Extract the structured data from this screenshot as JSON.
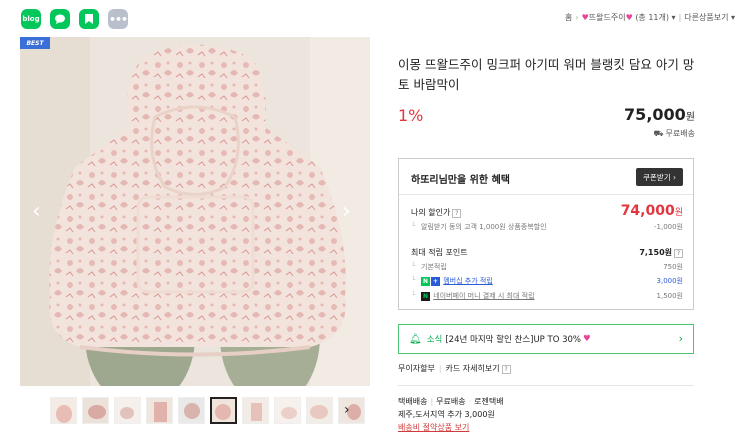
{
  "share": {
    "blog": "blog",
    "more": "•••"
  },
  "breadcrumb": {
    "home": "홈",
    "category": "뜨왈드주이",
    "count": "(총 11개)",
    "other": "다른상품보기"
  },
  "image": {
    "badge": "BEST",
    "prev": "‹",
    "next": "›",
    "thumb_next": "›"
  },
  "product": {
    "title": "이몽 뜨왈드주이 밍크퍼 아기띠 워머 블랭킷 담요 아기 망토 바람막이",
    "discount": "1%",
    "price": "75,000",
    "price_unit": "원",
    "shipping": "무료배송"
  },
  "benefit": {
    "title": "하또리님만을 위한 혜택",
    "coupon_button": "쿠폰받기 ›",
    "my_price_label": "나의 할인가",
    "my_price": "74,000",
    "my_price_unit": "원",
    "alarm_label": "알림받기 동의 고객 1,000원 상품중복할인",
    "alarm_value": "-1,000원",
    "points_label": "최대 적립 포인트",
    "points_value": "7,150원",
    "basic_label": "기본적립",
    "basic_value": "750원",
    "membership_label": "멤버십 추가 적립",
    "membership_value": "3,000원",
    "npay_label": "네이버페이 머니 결제 시 최대 적립",
    "npay_value": "1,500원"
  },
  "notice": {
    "label": "소식",
    "text": "[24년 마지막 할인 찬스]UP TO 30%"
  },
  "installment": {
    "label": "무이자할부",
    "card": "카드 자세히보기"
  },
  "delivery": {
    "line1_a": "택배배송",
    "line1_b": "무료배송",
    "line1_c": "로젠택배",
    "line2": "제주,도서지역 추가 3,000원",
    "saving_link": "배송비 절약상품 보기"
  },
  "colors": {
    "accent_red": "#e2373f",
    "naver_green": "#03c75a",
    "link_blue": "#2a5bd7"
  }
}
